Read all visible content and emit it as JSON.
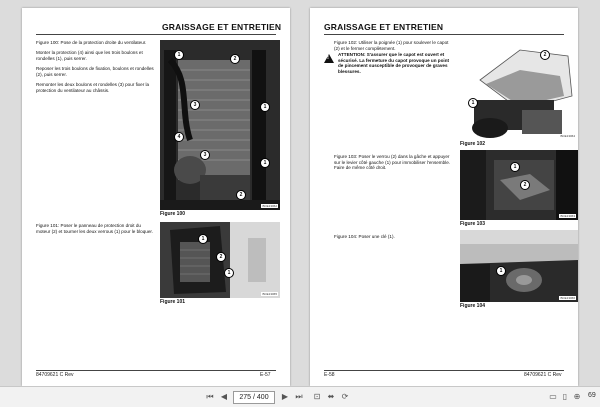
{
  "left_page": {
    "title": "GRAISSAGE ET ENTRETIEN",
    "para1": "Figure 100: Pose de la protection droite du ventilateur.",
    "para2": "Monter la protection (4) ainsi que les trois boulons et rondelles (1), puis serrer.",
    "para3": "Reposer les trois boulons de fixation, boulons et rondelles (2), puis serrer.",
    "para4": "Remonter les deux boulons et rondelles (3) pour fixer la protection du ventilateur au châssis.",
    "fig100_caption": "Figure 100",
    "fig101_text": "Figure 101: Poser le panneau de protection droit du moteur (2) et tourner les deux verrous (1) pour le bloquer.",
    "fig101_caption": "Figure 101",
    "footer_code": "84709621 C Rev",
    "footer_page": "E-57"
  },
  "right_page": {
    "title": "GRAISSAGE ET ENTRETIEN",
    "para1": "Figure 102: Utiliser la poignée (1) pour soulever le capot (2) et le fermer complètement.",
    "warning": "ATTENTION: S'assurer que le capot est ouvert et sécurisé. La fermeture du capot provoque un point de pincement susceptible de provoquer de graves blessures.",
    "fig102_caption": "Figure 102",
    "fig103_text": "Figure 103: Poser le verrou (2) dans la gâche et appuyer sur le levier côté gauche (1) pour immobiliser l'ensemble. Faire de même côté droit.",
    "fig103_caption": "Figure 103",
    "fig104_text": "Figure 104: Poser une clé (1).",
    "fig104_caption": "Figure 104",
    "footer_page": "E-58",
    "footer_code": "84709621 C Rev"
  },
  "photo_tags": [
    "BCE13062",
    "BCE13065",
    "BCE13064",
    "BCE13063",
    "BCE13066"
  ],
  "callouts": {
    "fig100": [
      "1",
      "2",
      "3",
      "4",
      "1",
      "2",
      "1",
      "3"
    ],
    "fig101": [
      "1",
      "2",
      "1"
    ],
    "fig102": [
      "1",
      "2"
    ],
    "fig103": [
      "1",
      "2"
    ],
    "fig104": [
      "1"
    ]
  },
  "toolbar": {
    "current_page": "275 / 400",
    "total_pages": "",
    "zoom": "69"
  }
}
